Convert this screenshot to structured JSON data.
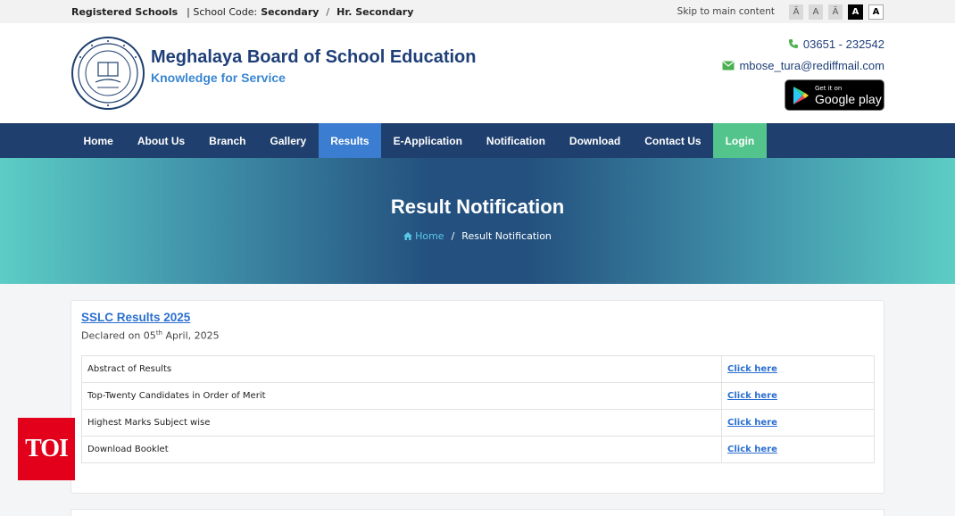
{
  "topbar": {
    "registered": "Registered Schools",
    "school_code_label": "| School Code:",
    "school_code_value": "Secondary",
    "separator": "/",
    "hr_secondary": "Hr. Secondary",
    "skip": "Skip to main content",
    "font_buttons": [
      "Ā",
      "A",
      "Ā",
      "A",
      "A"
    ]
  },
  "header": {
    "name": "Meghalaya Board of School Education",
    "tagline": "Knowledge for Service",
    "phone": "03651 - 232542",
    "email": "mbose_tura@rediffmail.com",
    "play_small": "Get it on",
    "play_big": "Google play"
  },
  "nav": {
    "items": [
      "Home",
      "About Us",
      "Branch",
      "Gallery",
      "Results",
      "E-Application",
      "Notification",
      "Download",
      "Contact Us",
      "Login"
    ],
    "active": "Results"
  },
  "banner": {
    "title": "Result Notification",
    "crumb_home": "Home",
    "crumb_sep": "/",
    "crumb_current": "Result Notification"
  },
  "result": {
    "title": "SSLC Results 2025",
    "declared_prefix": "Declared on 05",
    "declared_sup": "th",
    "declared_suffix": " April, 2025",
    "rows": [
      {
        "label": "Abstract of Results",
        "link": "Click here"
      },
      {
        "label": "Top-Twenty Candidates in Order of Merit",
        "link": "Click here"
      },
      {
        "label": "Highest Marks Subject wise",
        "link": "Click here"
      },
      {
        "label": "Download Booklet",
        "link": "Click here"
      }
    ]
  },
  "watermark": "TOI",
  "colors": {
    "navy": "#1f3f6e",
    "active_tab": "#3b7dd0",
    "login": "#52c48c",
    "link": "#2b6fd0",
    "toi_red": "#e2001a"
  }
}
